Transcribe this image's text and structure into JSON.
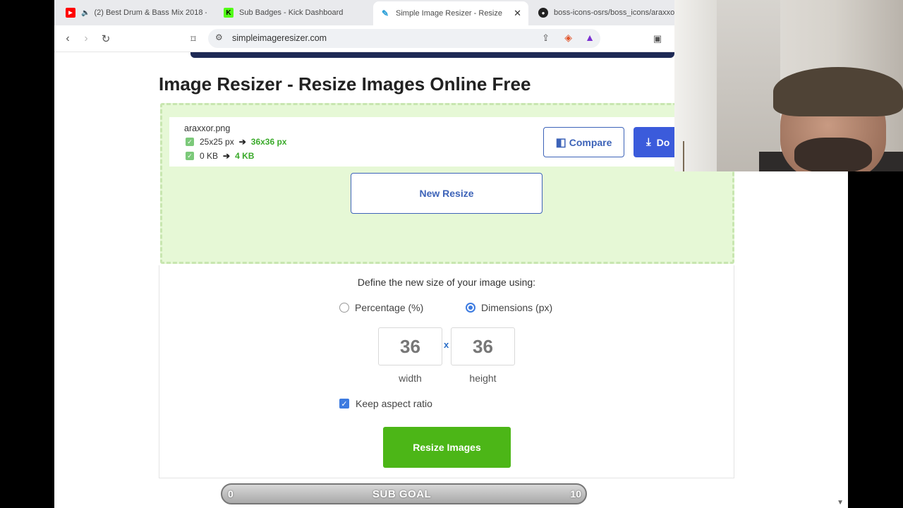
{
  "browser": {
    "tabs": [
      {
        "title": "(2) Best Drum & Bass Mix 2018 -",
        "icon": "youtube-icon",
        "muted_icon": "speaker-icon"
      },
      {
        "title": "Sub Badges - Kick Dashboard",
        "icon": "kick-icon"
      },
      {
        "title": "Simple Image Resizer - Resize Im",
        "icon": "resizer-icon",
        "active": true
      },
      {
        "title": "boss-icons-osrs/boss_icons/araxxor",
        "icon": "github-icon"
      }
    ],
    "url": "simpleimageresizer.com"
  },
  "page": {
    "title": "Image Resizer - Resize Images Online Free",
    "file": {
      "name": "araxxor.png",
      "old_dims": "25x25 px",
      "new_dims": "36x36 px",
      "old_size": "0 KB",
      "new_size": "4 KB"
    },
    "buttons": {
      "compare": "Compare",
      "download": "Do",
      "new_resize": "New Resize",
      "resize_images": "Resize Images"
    },
    "options": {
      "define_label": "Define the new size of your image using:",
      "percentage_label": "Percentage (%)",
      "dimensions_label": "Dimensions (px)",
      "selected": "dimensions",
      "width_value": "36",
      "height_value": "36",
      "separator": "x",
      "width_label": "width",
      "height_label": "height",
      "keep_aspect_label": "Keep aspect ratio",
      "keep_aspect_checked": true
    }
  },
  "overlay": {
    "sub_goal": {
      "min": "0",
      "label": "SUB GOAL",
      "max": "10"
    }
  },
  "colors": {
    "accent_blue": "#3d63b8",
    "resize_green": "#4cb617",
    "dropzone_bg": "#e6f8d6"
  }
}
